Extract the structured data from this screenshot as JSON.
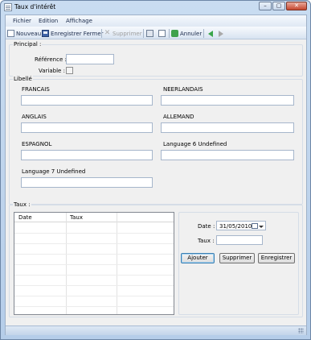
{
  "window": {
    "title": "Taux d'intérêt"
  },
  "menu": {
    "items": [
      "Fichier",
      "Edition",
      "Affichage"
    ]
  },
  "toolbar": {
    "new_label": "Nouveau",
    "save_close_label": "Enregistrer Fermer",
    "delete_label": "Supprimer",
    "undo_label": "Annuler"
  },
  "principal": {
    "group_label": "Principal :",
    "reference_label": "Référence :",
    "reference_value": "",
    "variable_label": "Variable :",
    "variable_checked": false
  },
  "libelle": {
    "group_label": "Libellé",
    "fields": [
      {
        "label": "FRANCAIS",
        "value": ""
      },
      {
        "label": "NEERLANDAIS",
        "value": ""
      },
      {
        "label": "ANGLAIS",
        "value": ""
      },
      {
        "label": "ALLEMAND",
        "value": ""
      },
      {
        "label": "ESPAGNOL",
        "value": ""
      },
      {
        "label": "Language 6 Undefined",
        "value": ""
      },
      {
        "label": "Language 7 Undefined",
        "value": ""
      }
    ]
  },
  "taux": {
    "group_label": "Taux :",
    "grid_columns": [
      "Date",
      "Taux"
    ],
    "date_label": "Date :",
    "date_value": "31/05/2010",
    "taux_label": "Taux :",
    "taux_value": "",
    "add_label": "Ajouter",
    "delete_label": "Supprimer",
    "save_label": "Enregistrer"
  },
  "icons": {
    "new": "new-document-icon",
    "save_close": "save-icon",
    "delete": "delete-x-icon",
    "print": "print-icon",
    "preview": "print-preview-icon",
    "undo": "undo-icon",
    "back": "back-arrow-icon",
    "forward": "forward-arrow-icon",
    "calendar": "calendar-icon"
  },
  "colors": {
    "accent": "#3aa54a",
    "title_bar": "#c9dcf1"
  }
}
